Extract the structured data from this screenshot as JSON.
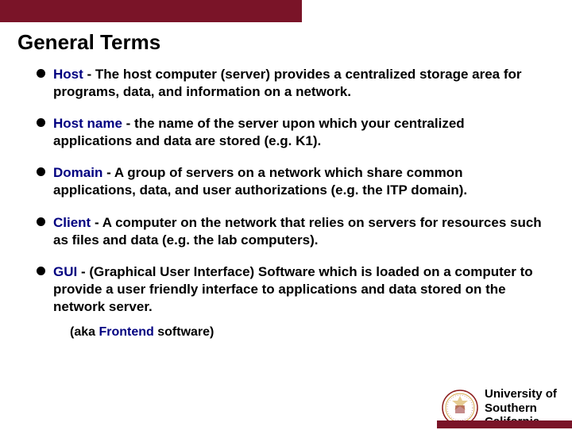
{
  "title": "General Terms",
  "bullets": [
    {
      "term": "Host",
      "definition": " - The host computer (server) provides a centralized storage area for programs, data, and information on a network."
    },
    {
      "term": "Host name",
      "definition": " - the name of the server upon which your centralized applications and data are stored (e.g. K1)."
    },
    {
      "term": "Domain",
      "definition": " - A group of servers on a network which share common applications, data, and user authorizations (e.g. the ITP domain)."
    },
    {
      "term": "Client",
      "definition": " - A computer on the network that relies on servers for resources such as files and data (e.g. the lab computers)."
    },
    {
      "term": "GUI",
      "definition": " - (Graphical User Interface) Software which is loaded on a computer to provide a user friendly interface to applications and data stored on the network server."
    }
  ],
  "note_prefix": "(aka ",
  "note_term": "Frontend",
  "note_suffix": " software)",
  "university": {
    "line1": "University of",
    "line2": "Southern",
    "line3": "California"
  }
}
